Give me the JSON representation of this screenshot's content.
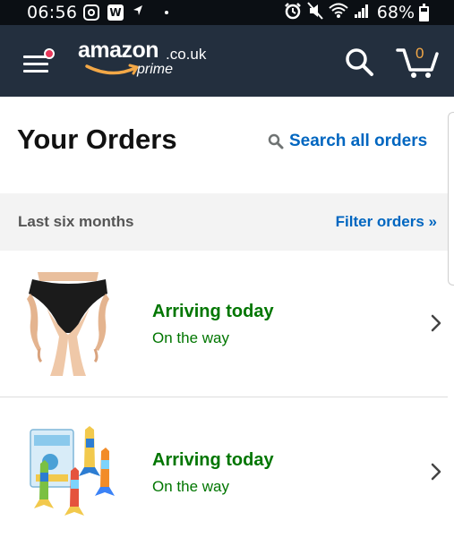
{
  "status_bar": {
    "time": "06:56",
    "battery_percent": "68%",
    "battery_level": 0.68,
    "left_icons": [
      "instagram-icon",
      "w-app-icon",
      "navigation-icon",
      "dot-icon"
    ],
    "right_icons": [
      "alarm-icon",
      "mute-icon",
      "wifi-icon",
      "signal-icon",
      "battery-icon"
    ]
  },
  "header": {
    "logo_word": "amazon",
    "logo_tld": ".co.uk",
    "logo_prime": "prime",
    "cart_count": "0",
    "colors": {
      "background": "#232f3e",
      "accent": "#f3a847",
      "notification_dot": "#e8385a"
    }
  },
  "page": {
    "title": "Your Orders",
    "search_link": "Search all orders"
  },
  "filter": {
    "period": "Last six months",
    "filter_link": "Filter orders »"
  },
  "orders": [
    {
      "status": "Arriving today",
      "substatus": "On the way",
      "thumbnail": "black-briefs-product"
    },
    {
      "status": "Arriving today",
      "substatus": "On the way",
      "thumbnail": "dive-torpedo-toys-product"
    }
  ],
  "colors": {
    "link": "#0066c0",
    "status_green": "#007600"
  }
}
